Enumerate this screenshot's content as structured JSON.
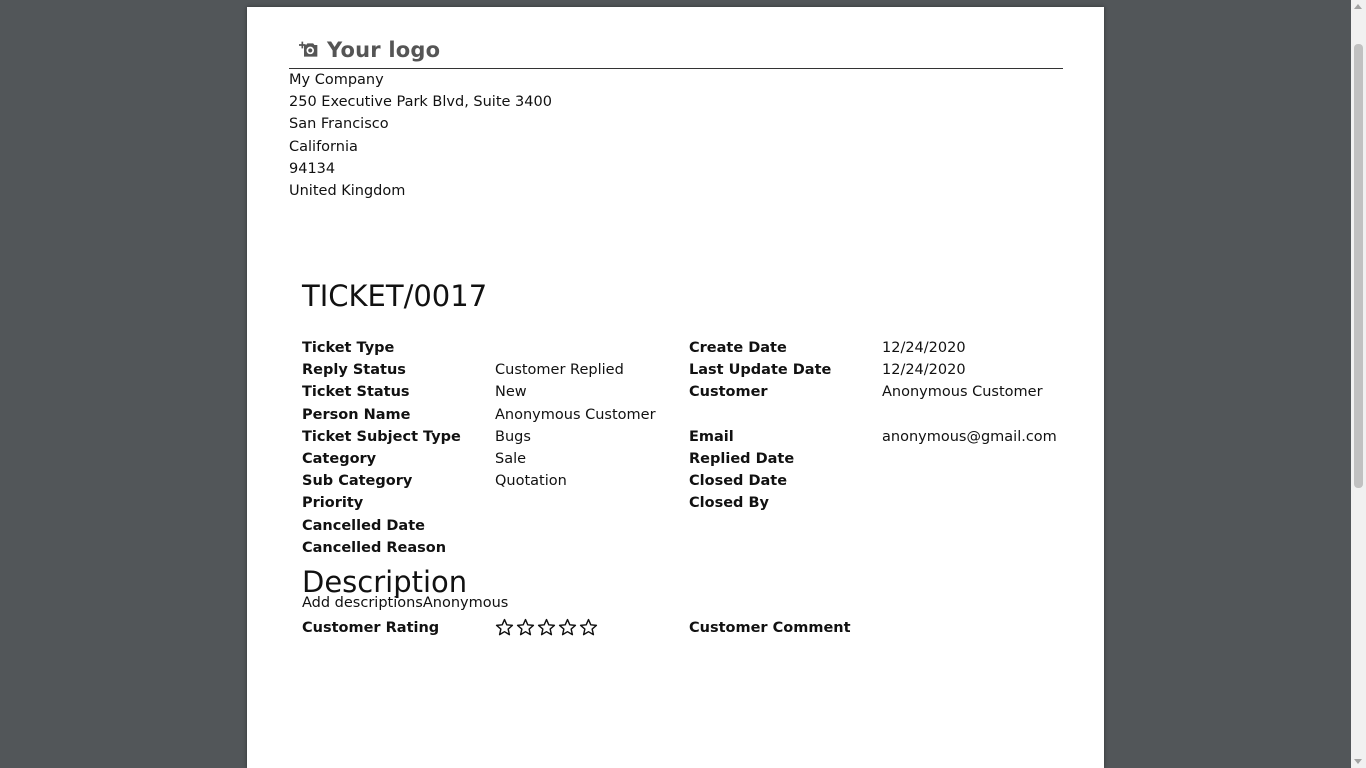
{
  "logo": {
    "text": "Your logo",
    "icon": "camera-plus-icon"
  },
  "company": {
    "name": "My Company",
    "street": "250 Executive Park Blvd, Suite 3400",
    "city": "San Francisco",
    "state": "California",
    "zip": "94134",
    "country": "United Kingdom"
  },
  "ticket": {
    "number": "TICKET/0017",
    "labels": {
      "ticket_type": "Ticket Type",
      "reply_status": "Reply Status",
      "ticket_status": "Ticket Status",
      "person_name": "Person Name",
      "subject_type": "Ticket Subject Type",
      "category": "Category",
      "sub_category": "Sub Category",
      "priority": "Priority",
      "cancelled_date": "Cancelled Date",
      "cancelled_reason": "Cancelled Reason",
      "create_date": "Create Date",
      "last_update_date": "Last Update Date",
      "customer": "Customer",
      "email": "Email",
      "replied_date": "Replied Date",
      "closed_date": "Closed Date",
      "closed_by": "Closed By",
      "customer_rating": "Customer Rating",
      "customer_comment": "Customer Comment"
    },
    "values": {
      "reply_status": "Customer Replied",
      "ticket_status": "New",
      "person_name": "Anonymous Customer",
      "subject_type": "Bugs",
      "category": "Sale",
      "sub_category": "Quotation",
      "create_date": "12/24/2020",
      "last_update_date": "12/24/2020",
      "customer": "Anonymous Customer",
      "email": "anonymous@gmail.com"
    }
  },
  "description": {
    "title": "Description",
    "text": "Add descriptionsAnonymous"
  },
  "rating": {
    "value": 0,
    "max": 5
  }
}
